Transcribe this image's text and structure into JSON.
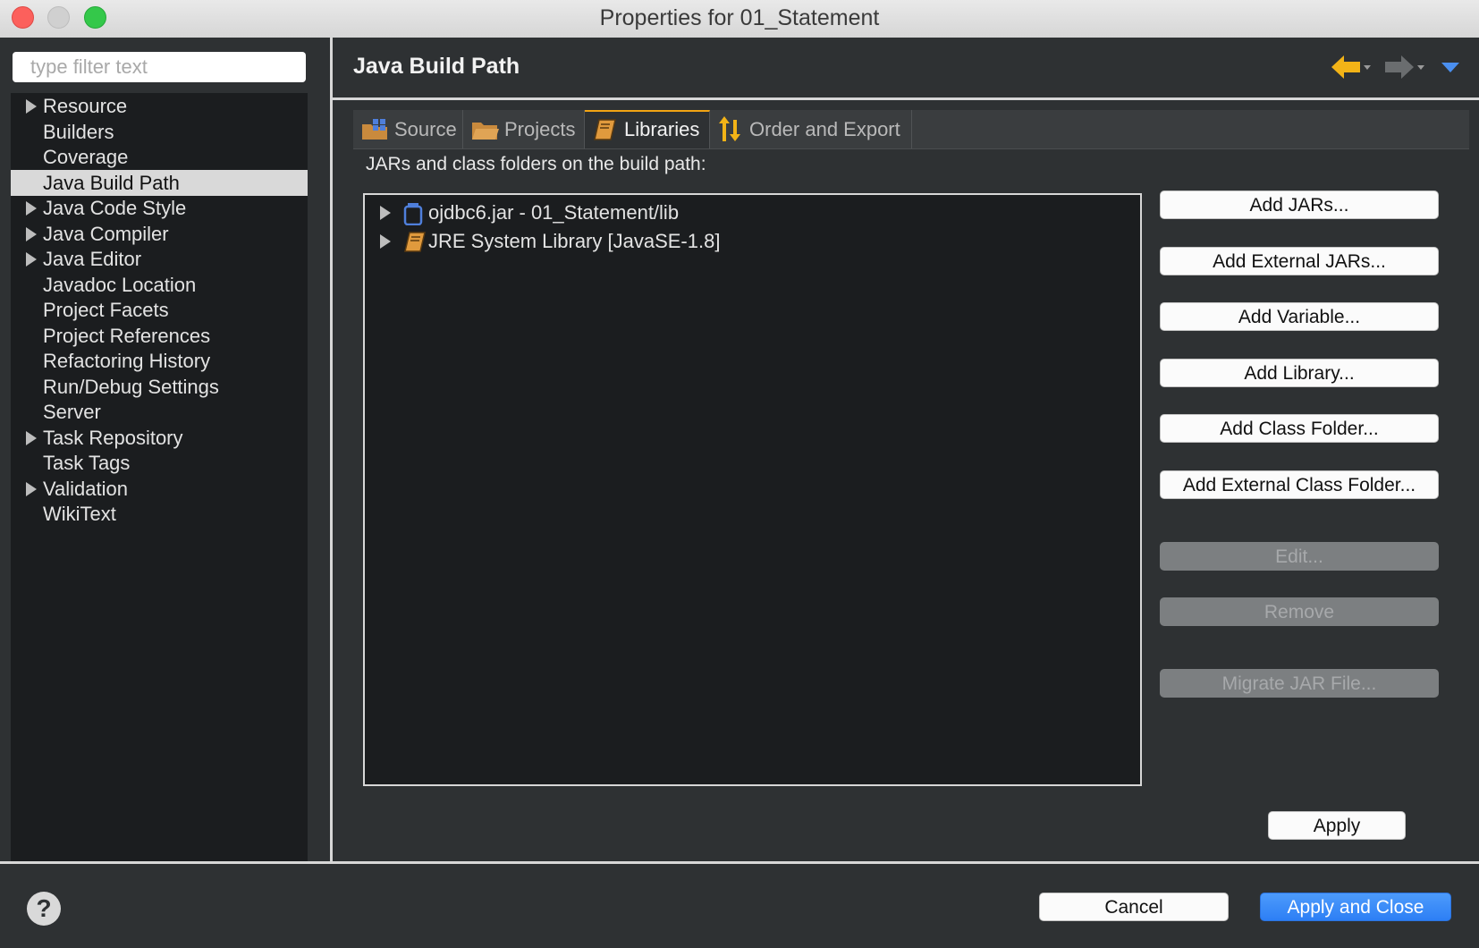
{
  "window": {
    "title": "Properties for 01_Statement"
  },
  "sidebar": {
    "filter_placeholder": "type filter text",
    "items": [
      {
        "label": "Resource",
        "expandable": true
      },
      {
        "label": "Builders",
        "expandable": false
      },
      {
        "label": "Coverage",
        "expandable": false
      },
      {
        "label": "Java Build Path",
        "expandable": false,
        "selected": true
      },
      {
        "label": "Java Code Style",
        "expandable": true
      },
      {
        "label": "Java Compiler",
        "expandable": true
      },
      {
        "label": "Java Editor",
        "expandable": true
      },
      {
        "label": "Javadoc Location",
        "expandable": false
      },
      {
        "label": "Project Facets",
        "expandable": false
      },
      {
        "label": "Project References",
        "expandable": false
      },
      {
        "label": "Refactoring History",
        "expandable": false
      },
      {
        "label": "Run/Debug Settings",
        "expandable": false
      },
      {
        "label": "Server",
        "expandable": false
      },
      {
        "label": "Task Repository",
        "expandable": true
      },
      {
        "label": "Task Tags",
        "expandable": false
      },
      {
        "label": "Validation",
        "expandable": true
      },
      {
        "label": "WikiText",
        "expandable": false
      }
    ]
  },
  "main": {
    "title": "Java Build Path",
    "tabs": [
      {
        "label": "Source",
        "icon": "source-folder-icon"
      },
      {
        "label": "Projects",
        "icon": "folder-icon"
      },
      {
        "label": "Libraries",
        "icon": "library-icon",
        "active": true
      },
      {
        "label": "Order and Export",
        "icon": "order-arrows-icon"
      }
    ],
    "section_label": "JARs and class folders on the build path:",
    "libraries": [
      {
        "label": "ojdbc6.jar - 01_Statement/lib",
        "icon": "jar-icon"
      },
      {
        "label": "JRE System Library [JavaSE-1.8]",
        "icon": "library-icon"
      }
    ],
    "buttons": {
      "add_jars": "Add JARs...",
      "add_external_jars": "Add External JARs...",
      "add_variable": "Add Variable...",
      "add_library": "Add Library...",
      "add_class_folder": "Add Class Folder...",
      "add_external_class_folder": "Add External Class Folder...",
      "edit": "Edit...",
      "remove": "Remove",
      "migrate_jar": "Migrate JAR File..."
    },
    "apply": "Apply"
  },
  "footer": {
    "help": "?",
    "cancel": "Cancel",
    "apply_and_close": "Apply and Close"
  },
  "colors": {
    "accent": "#f2a413",
    "primary_button": "#2d7ff5",
    "background": "#2e3133",
    "tree_background": "#1b1d1f"
  }
}
